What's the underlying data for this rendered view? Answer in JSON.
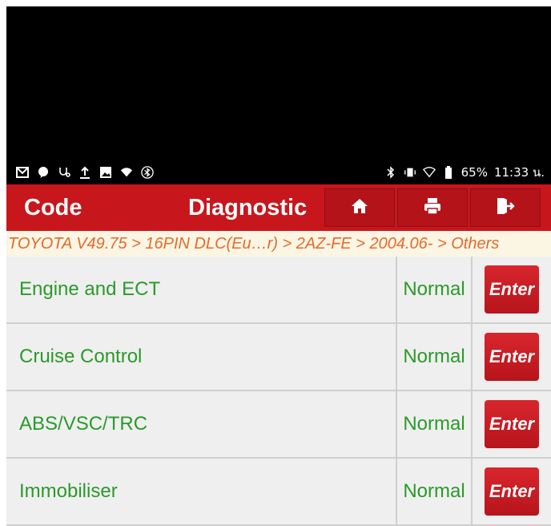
{
  "status_bar": {
    "left_icons": [
      "gmail-icon",
      "message-icon",
      "stethoscope-icon",
      "upload-icon",
      "image-icon",
      "wifi-question-icon",
      "bluetooth-circle-icon"
    ],
    "battery": "65%",
    "time": "11:33 น."
  },
  "header": {
    "title_left": "Code",
    "title_right": "Diagnostic",
    "buttons": [
      "home-icon",
      "print-icon",
      "exit-icon"
    ]
  },
  "breadcrumb": "TOYOTA V49.75 > 16PIN DLC(Eu…r) > 2AZ-FE > 2004.06- > Others",
  "systems": [
    {
      "name": "Engine and ECT",
      "status": "Normal",
      "action": "Enter"
    },
    {
      "name": "Cruise Control",
      "status": "Normal",
      "action": "Enter"
    },
    {
      "name": "ABS/VSC/TRC",
      "status": "Normal",
      "action": "Enter"
    },
    {
      "name": "Immobiliser",
      "status": "Normal",
      "action": "Enter"
    }
  ],
  "colors": {
    "header": "#c8161d",
    "breadcrumb_text": "#e46a2e",
    "row_text": "#2a9a2a",
    "enter_button": "#c8161d"
  }
}
